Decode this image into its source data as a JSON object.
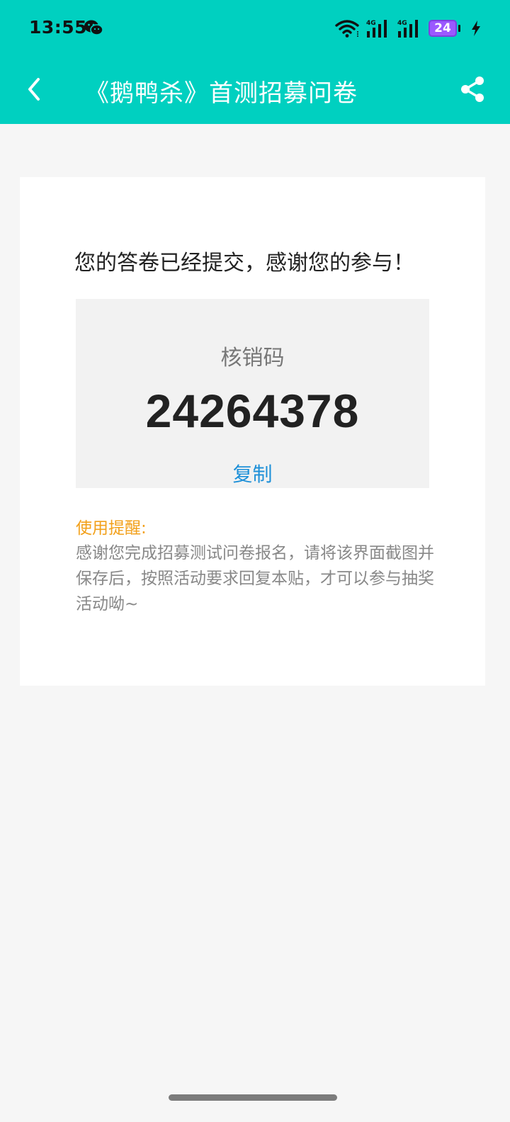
{
  "status_bar": {
    "time": "13:55",
    "battery_level": "24",
    "network_label_1": "4G",
    "network_label_2": "4G",
    "icons": [
      "wechat-icon",
      "wifi-icon",
      "signal-icon",
      "battery-icon",
      "charging-bolt-icon"
    ]
  },
  "navbar": {
    "title": "《鹅鸭杀》首测招募问卷",
    "back_icon": "chevron-left-icon",
    "share_icon": "share-icon",
    "background_color": "#00d0c0"
  },
  "content": {
    "headline": "您的答卷已经提交，感谢您的参与！",
    "code_label": "核销码",
    "code_value": "24264378",
    "copy_label": "复制",
    "reminder_title": "使用提醒:",
    "reminder_text": "感谢您完成招募测试问卷报名，请将该界面截图并保存后，按照活动要求回复本贴，才可以参与抽奖活动呦~"
  },
  "colors": {
    "accent": "#00d0c0",
    "link": "#1e90d8",
    "reminder_title": "#f2a01a",
    "battery": "#9b59ff"
  }
}
